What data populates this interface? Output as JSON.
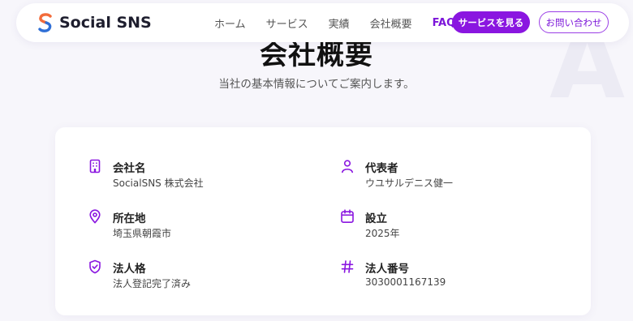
{
  "nav": {
    "brand": "Social SNS",
    "links": [
      "ホーム",
      "サービス",
      "実績",
      "会社概要",
      "FAQ"
    ],
    "active": "FAQ",
    "cta_primary": "サービスを見る",
    "cta_secondary": "お問い合わせ"
  },
  "colors": {
    "accent": "#8a16e0",
    "logo_orange": "#f26b3a",
    "logo_blue": "#2f6fd6"
  },
  "page": {
    "title": "会社概要",
    "subtitle": "当社の基本情報についてご案内します。",
    "background_text": "A"
  },
  "info": [
    {
      "icon": "building-icon",
      "label": "会社名",
      "value": "SocialSNS 株式会社"
    },
    {
      "icon": "user-icon",
      "label": "代表者",
      "value": "ウユサルデニス健一"
    },
    {
      "icon": "map-pin-icon",
      "label": "所在地",
      "value": "埼玉県朝霞市"
    },
    {
      "icon": "calendar-icon",
      "label": "設立",
      "value": "2025年"
    },
    {
      "icon": "shield-check-icon",
      "label": "法人格",
      "value": "法人登記完了済み"
    },
    {
      "icon": "hash-icon",
      "label": "法人番号",
      "value": "3030001167139"
    }
  ]
}
